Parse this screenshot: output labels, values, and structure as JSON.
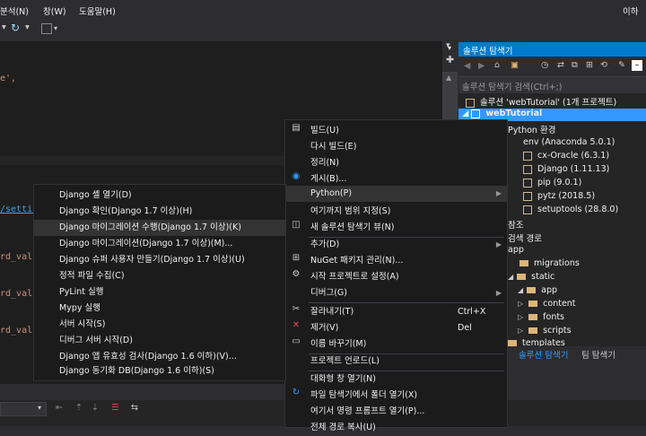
{
  "menubar": {
    "analyze": "분석(N)",
    "window": "창(W)",
    "help": "도움말(H)",
    "user": "이하얀"
  },
  "editor": {
    "line1": "e',",
    "line2": "/settin",
    "line3": "rd_vali",
    "line4": "rd_vali",
    "line5": "rd_vali"
  },
  "solution_explorer": {
    "title": "솔루션 탐색기",
    "search_placeholder": "솔루션 탐색기 검색(Ctrl+;)",
    "tree": [
      "솔루션 'webTutorial' (1개 프로젝트)",
      "webTutorial",
      "Python 환경",
      "env (Anaconda 5.0.1)",
      "cx-Oracle (6.3.1)",
      "Django (1.11.13)",
      "pip (9.0.1)",
      "pytz (2018.5)",
      "setuptools (28.8.0)",
      "참조",
      "검색 경로",
      "app",
      "migrations",
      "static",
      "app",
      "content",
      "fonts",
      "scripts",
      "templates"
    ],
    "tab_solution": "솔루션 탐색기",
    "tab_team": "팀 탐색기"
  },
  "context_menu": {
    "build": "빌드(U)",
    "rebuild": "다시 빌드(E)",
    "clean": "정리(N)",
    "publish": "게시(B)...",
    "python": "Python(P)",
    "scope": "여기까지 범위 지정(S)",
    "new_view": "새 솔루션 탐색기 뷰(N)",
    "add": "추가(D)",
    "nuget": "NuGet 패키지 관리(N)...",
    "startup": "시작 프로젝트로 설정(A)",
    "debug": "디버그(G)",
    "cut": "잘라내기(T)",
    "cut_shortcut": "Ctrl+X",
    "remove": "제거(V)",
    "remove_shortcut": "Del",
    "rename": "이름 바꾸기(M)",
    "unload": "프로젝트 언로드(L)",
    "interactive": "대화형 창 열기(N)",
    "open_folder": "파일 탐색기에서 폴더 열기(X)",
    "open_cmd": "여기서 명령 프롬프트 열기(P)...",
    "copy_path": "전체 경로 복사(U)"
  },
  "python_submenu": [
    "Django 셸 열기(D)",
    "Django 확인(Django 1.7 이상)(H)",
    "Django 마이그레이션 수행(Django 1.7 이상)(K)",
    "Django 마이그레이션(Django 1.7 이상)(M)...",
    "Django 슈퍼 사용자 만들기(Django 1.7 이상)(U)",
    "정적 파일 수집(C)",
    "PyLint 실행",
    "Mypy 실행",
    "서버 시작(S)",
    "디버그 서버 시작(D)",
    "Django 앱 유효성 검사(Django 1.6 이하)(V)...",
    "Django 동기화 DB(Django 1.6 이하)(S)"
  ]
}
